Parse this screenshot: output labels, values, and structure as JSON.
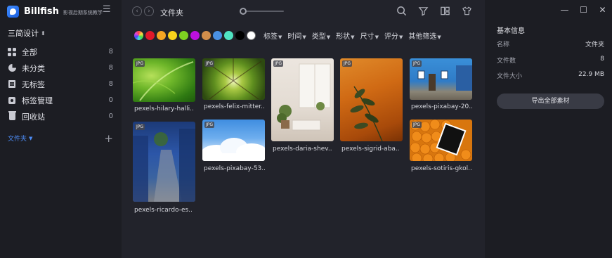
{
  "app": {
    "name": "Billfish",
    "subtitle": "影视后期系统教学"
  },
  "sidebar": {
    "library_name": "三简设计",
    "items": [
      {
        "label": "全部",
        "count": "8",
        "icon": "grid-icon"
      },
      {
        "label": "未分类",
        "count": "8",
        "icon": "pie-icon"
      },
      {
        "label": "无标签",
        "count": "8",
        "icon": "document-icon"
      },
      {
        "label": "标签管理",
        "count": "0",
        "icon": "tag-icon"
      },
      {
        "label": "回收站",
        "count": "0",
        "icon": "trash-icon"
      }
    ],
    "folders_label": "文件夹",
    "add_label": "+"
  },
  "toolbar": {
    "back_label": "‹",
    "forward_label": "›",
    "breadcrumb": "文件夹",
    "zoom_level": 0
  },
  "filters": {
    "colors": [
      "rainbow",
      "#e0192a",
      "#f5a623",
      "#f8d21c",
      "#7ed321",
      "#bd10e0",
      "#d28e4b",
      "#4a90e2",
      "#50e3c2",
      "#000000",
      "#ffffff"
    ],
    "dropdowns": [
      "标签",
      "时间",
      "类型",
      "形状",
      "尺寸",
      "评分",
      "其他筛选"
    ]
  },
  "files": [
    {
      "name": "pexels-hilary-halli..",
      "type": "JPG"
    },
    {
      "name": "pexels-felix-mitter..",
      "type": "JPG"
    },
    {
      "name": "pexels-daria-shev..",
      "type": "JPG"
    },
    {
      "name": "pexels-sigrid-aba..",
      "type": "JPG"
    },
    {
      "name": "pexels-pixabay-20..",
      "type": "JPG"
    },
    {
      "name": "pexels-ricardo-es..",
      "type": "JPG"
    },
    {
      "name": "pexels-pixabay-53..",
      "type": "JPG"
    },
    {
      "name": "pexels-sotiris-gkol..",
      "type": "JPG"
    }
  ],
  "info": {
    "title": "基本信息",
    "rows": [
      {
        "key": "名称",
        "value": "文件夹"
      },
      {
        "key": "文件数",
        "value": "8"
      },
      {
        "key": "文件大小",
        "value": "22.9 MB"
      }
    ],
    "export_label": "导出全部素材"
  },
  "window": {
    "minimize": "—",
    "maximize": "☐",
    "close": "✕"
  }
}
